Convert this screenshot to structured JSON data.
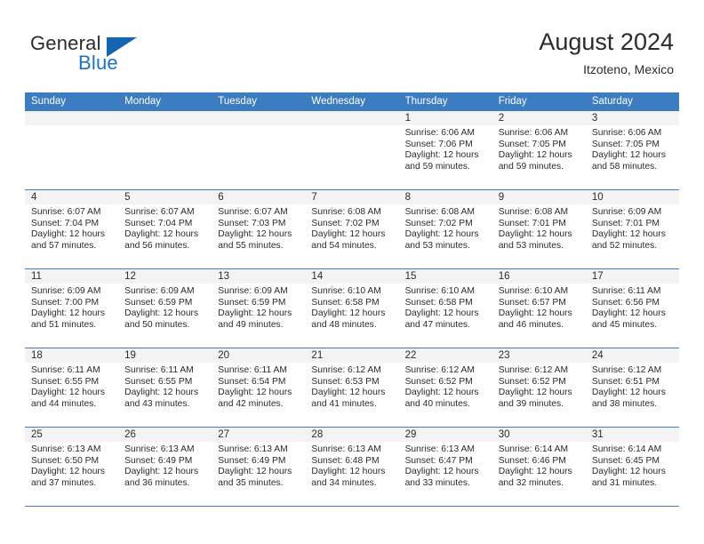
{
  "brand": {
    "name_part1": "General",
    "name_part2": "Blue",
    "triangle_color": "#1566b0",
    "blue_color": "#1a73c4"
  },
  "header": {
    "title": "August 2024",
    "location": "Itzoteno, Mexico"
  },
  "theme": {
    "header_row_bg": "#3b7dc0",
    "daynum_band_bg": "#f3f3f3",
    "row_separator": "#3b7dc0",
    "text": "#2b2b2b"
  },
  "weekdays": [
    "Sunday",
    "Monday",
    "Tuesday",
    "Wednesday",
    "Thursday",
    "Friday",
    "Saturday"
  ],
  "weeks": [
    [
      {
        "day": "",
        "sunrise": "",
        "sunset": "",
        "daylight_line1": "",
        "daylight_line2": "",
        "empty": true
      },
      {
        "day": "",
        "sunrise": "",
        "sunset": "",
        "daylight_line1": "",
        "daylight_line2": "",
        "empty": true
      },
      {
        "day": "",
        "sunrise": "",
        "sunset": "",
        "daylight_line1": "",
        "daylight_line2": "",
        "empty": true
      },
      {
        "day": "",
        "sunrise": "",
        "sunset": "",
        "daylight_line1": "",
        "daylight_line2": "",
        "empty": true
      },
      {
        "day": "1",
        "sunrise": "Sunrise: 6:06 AM",
        "sunset": "Sunset: 7:06 PM",
        "daylight_line1": "Daylight: 12 hours",
        "daylight_line2": "and 59 minutes."
      },
      {
        "day": "2",
        "sunrise": "Sunrise: 6:06 AM",
        "sunset": "Sunset: 7:05 PM",
        "daylight_line1": "Daylight: 12 hours",
        "daylight_line2": "and 59 minutes."
      },
      {
        "day": "3",
        "sunrise": "Sunrise: 6:06 AM",
        "sunset": "Sunset: 7:05 PM",
        "daylight_line1": "Daylight: 12 hours",
        "daylight_line2": "and 58 minutes."
      }
    ],
    [
      {
        "day": "4",
        "sunrise": "Sunrise: 6:07 AM",
        "sunset": "Sunset: 7:04 PM",
        "daylight_line1": "Daylight: 12 hours",
        "daylight_line2": "and 57 minutes."
      },
      {
        "day": "5",
        "sunrise": "Sunrise: 6:07 AM",
        "sunset": "Sunset: 7:04 PM",
        "daylight_line1": "Daylight: 12 hours",
        "daylight_line2": "and 56 minutes."
      },
      {
        "day": "6",
        "sunrise": "Sunrise: 6:07 AM",
        "sunset": "Sunset: 7:03 PM",
        "daylight_line1": "Daylight: 12 hours",
        "daylight_line2": "and 55 minutes."
      },
      {
        "day": "7",
        "sunrise": "Sunrise: 6:08 AM",
        "sunset": "Sunset: 7:02 PM",
        "daylight_line1": "Daylight: 12 hours",
        "daylight_line2": "and 54 minutes."
      },
      {
        "day": "8",
        "sunrise": "Sunrise: 6:08 AM",
        "sunset": "Sunset: 7:02 PM",
        "daylight_line1": "Daylight: 12 hours",
        "daylight_line2": "and 53 minutes."
      },
      {
        "day": "9",
        "sunrise": "Sunrise: 6:08 AM",
        "sunset": "Sunset: 7:01 PM",
        "daylight_line1": "Daylight: 12 hours",
        "daylight_line2": "and 53 minutes."
      },
      {
        "day": "10",
        "sunrise": "Sunrise: 6:09 AM",
        "sunset": "Sunset: 7:01 PM",
        "daylight_line1": "Daylight: 12 hours",
        "daylight_line2": "and 52 minutes."
      }
    ],
    [
      {
        "day": "11",
        "sunrise": "Sunrise: 6:09 AM",
        "sunset": "Sunset: 7:00 PM",
        "daylight_line1": "Daylight: 12 hours",
        "daylight_line2": "and 51 minutes."
      },
      {
        "day": "12",
        "sunrise": "Sunrise: 6:09 AM",
        "sunset": "Sunset: 6:59 PM",
        "daylight_line1": "Daylight: 12 hours",
        "daylight_line2": "and 50 minutes."
      },
      {
        "day": "13",
        "sunrise": "Sunrise: 6:09 AM",
        "sunset": "Sunset: 6:59 PM",
        "daylight_line1": "Daylight: 12 hours",
        "daylight_line2": "and 49 minutes."
      },
      {
        "day": "14",
        "sunrise": "Sunrise: 6:10 AM",
        "sunset": "Sunset: 6:58 PM",
        "daylight_line1": "Daylight: 12 hours",
        "daylight_line2": "and 48 minutes."
      },
      {
        "day": "15",
        "sunrise": "Sunrise: 6:10 AM",
        "sunset": "Sunset: 6:58 PM",
        "daylight_line1": "Daylight: 12 hours",
        "daylight_line2": "and 47 minutes."
      },
      {
        "day": "16",
        "sunrise": "Sunrise: 6:10 AM",
        "sunset": "Sunset: 6:57 PM",
        "daylight_line1": "Daylight: 12 hours",
        "daylight_line2": "and 46 minutes."
      },
      {
        "day": "17",
        "sunrise": "Sunrise: 6:11 AM",
        "sunset": "Sunset: 6:56 PM",
        "daylight_line1": "Daylight: 12 hours",
        "daylight_line2": "and 45 minutes."
      }
    ],
    [
      {
        "day": "18",
        "sunrise": "Sunrise: 6:11 AM",
        "sunset": "Sunset: 6:55 PM",
        "daylight_line1": "Daylight: 12 hours",
        "daylight_line2": "and 44 minutes."
      },
      {
        "day": "19",
        "sunrise": "Sunrise: 6:11 AM",
        "sunset": "Sunset: 6:55 PM",
        "daylight_line1": "Daylight: 12 hours",
        "daylight_line2": "and 43 minutes."
      },
      {
        "day": "20",
        "sunrise": "Sunrise: 6:11 AM",
        "sunset": "Sunset: 6:54 PM",
        "daylight_line1": "Daylight: 12 hours",
        "daylight_line2": "and 42 minutes."
      },
      {
        "day": "21",
        "sunrise": "Sunrise: 6:12 AM",
        "sunset": "Sunset: 6:53 PM",
        "daylight_line1": "Daylight: 12 hours",
        "daylight_line2": "and 41 minutes."
      },
      {
        "day": "22",
        "sunrise": "Sunrise: 6:12 AM",
        "sunset": "Sunset: 6:52 PM",
        "daylight_line1": "Daylight: 12 hours",
        "daylight_line2": "and 40 minutes."
      },
      {
        "day": "23",
        "sunrise": "Sunrise: 6:12 AM",
        "sunset": "Sunset: 6:52 PM",
        "daylight_line1": "Daylight: 12 hours",
        "daylight_line2": "and 39 minutes."
      },
      {
        "day": "24",
        "sunrise": "Sunrise: 6:12 AM",
        "sunset": "Sunset: 6:51 PM",
        "daylight_line1": "Daylight: 12 hours",
        "daylight_line2": "and 38 minutes."
      }
    ],
    [
      {
        "day": "25",
        "sunrise": "Sunrise: 6:13 AM",
        "sunset": "Sunset: 6:50 PM",
        "daylight_line1": "Daylight: 12 hours",
        "daylight_line2": "and 37 minutes."
      },
      {
        "day": "26",
        "sunrise": "Sunrise: 6:13 AM",
        "sunset": "Sunset: 6:49 PM",
        "daylight_line1": "Daylight: 12 hours",
        "daylight_line2": "and 36 minutes."
      },
      {
        "day": "27",
        "sunrise": "Sunrise: 6:13 AM",
        "sunset": "Sunset: 6:49 PM",
        "daylight_line1": "Daylight: 12 hours",
        "daylight_line2": "and 35 minutes."
      },
      {
        "day": "28",
        "sunrise": "Sunrise: 6:13 AM",
        "sunset": "Sunset: 6:48 PM",
        "daylight_line1": "Daylight: 12 hours",
        "daylight_line2": "and 34 minutes."
      },
      {
        "day": "29",
        "sunrise": "Sunrise: 6:13 AM",
        "sunset": "Sunset: 6:47 PM",
        "daylight_line1": "Daylight: 12 hours",
        "daylight_line2": "and 33 minutes."
      },
      {
        "day": "30",
        "sunrise": "Sunrise: 6:14 AM",
        "sunset": "Sunset: 6:46 PM",
        "daylight_line1": "Daylight: 12 hours",
        "daylight_line2": "and 32 minutes."
      },
      {
        "day": "31",
        "sunrise": "Sunrise: 6:14 AM",
        "sunset": "Sunset: 6:45 PM",
        "daylight_line1": "Daylight: 12 hours",
        "daylight_line2": "and 31 minutes."
      }
    ]
  ]
}
